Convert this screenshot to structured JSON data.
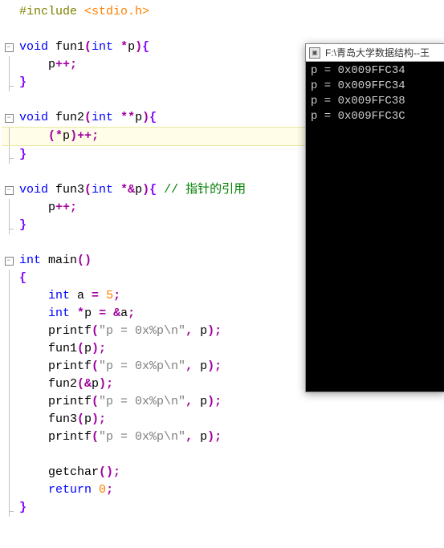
{
  "editor": {
    "lines": [
      {
        "fold": "none",
        "segments": [
          {
            "t": "#include ",
            "c": "inc"
          },
          {
            "t": "<stdio.h>",
            "c": "incfile"
          }
        ]
      },
      {
        "fold": "none",
        "segments": []
      },
      {
        "fold": "start",
        "segments": [
          {
            "t": "void",
            "c": "kw"
          },
          {
            "t": " fun1",
            "c": "ident"
          },
          {
            "t": "(",
            "c": "op"
          },
          {
            "t": "int",
            "c": "kw"
          },
          {
            "t": " ",
            "c": ""
          },
          {
            "t": "*",
            "c": "ptr"
          },
          {
            "t": "p",
            "c": "ident"
          },
          {
            "t": ")",
            "c": "op"
          },
          {
            "t": "{",
            "c": "brace"
          }
        ]
      },
      {
        "fold": "mid",
        "segments": [
          {
            "t": "    p",
            "c": "ident"
          },
          {
            "t": "++",
            "c": "op"
          },
          {
            "t": ";",
            "c": "op"
          }
        ]
      },
      {
        "fold": "end",
        "segments": [
          {
            "t": "}",
            "c": "brace"
          }
        ]
      },
      {
        "fold": "none",
        "segments": []
      },
      {
        "fold": "start",
        "segments": [
          {
            "t": "void",
            "c": "kw"
          },
          {
            "t": " fun2",
            "c": "ident"
          },
          {
            "t": "(",
            "c": "op"
          },
          {
            "t": "int",
            "c": "kw"
          },
          {
            "t": " ",
            "c": ""
          },
          {
            "t": "**",
            "c": "ptr"
          },
          {
            "t": "p",
            "c": "ident"
          },
          {
            "t": ")",
            "c": "op"
          },
          {
            "t": "{",
            "c": "brace"
          }
        ]
      },
      {
        "fold": "mid",
        "highlight": true,
        "segments": [
          {
            "t": "    ",
            "c": ""
          },
          {
            "t": "(",
            "c": "op"
          },
          {
            "t": "*",
            "c": "ptr"
          },
          {
            "t": "p",
            "c": "ident"
          },
          {
            "t": ")",
            "c": "op"
          },
          {
            "t": "++",
            "c": "op"
          },
          {
            "t": ";",
            "c": "op"
          }
        ]
      },
      {
        "fold": "end",
        "segments": [
          {
            "t": "}",
            "c": "brace"
          }
        ]
      },
      {
        "fold": "none",
        "segments": []
      },
      {
        "fold": "start",
        "segments": [
          {
            "t": "void",
            "c": "kw"
          },
          {
            "t": " fun3",
            "c": "ident"
          },
          {
            "t": "(",
            "c": "op"
          },
          {
            "t": "int",
            "c": "kw"
          },
          {
            "t": " ",
            "c": ""
          },
          {
            "t": "*&",
            "c": "ptr"
          },
          {
            "t": "p",
            "c": "ident"
          },
          {
            "t": ")",
            "c": "op"
          },
          {
            "t": "{",
            "c": "brace"
          },
          {
            "t": " ",
            "c": ""
          },
          {
            "t": "// 指针的引用",
            "c": "cmt"
          }
        ]
      },
      {
        "fold": "mid",
        "segments": [
          {
            "t": "    p",
            "c": "ident"
          },
          {
            "t": "++",
            "c": "op"
          },
          {
            "t": ";",
            "c": "op"
          }
        ]
      },
      {
        "fold": "end",
        "segments": [
          {
            "t": "}",
            "c": "brace"
          }
        ]
      },
      {
        "fold": "none",
        "segments": []
      },
      {
        "fold": "start",
        "segments": [
          {
            "t": "int",
            "c": "kw"
          },
          {
            "t": " main",
            "c": "ident"
          },
          {
            "t": "()",
            "c": "op"
          }
        ]
      },
      {
        "fold": "mid",
        "segments": [
          {
            "t": "{",
            "c": "brace"
          }
        ]
      },
      {
        "fold": "mid",
        "segments": [
          {
            "t": "    ",
            "c": ""
          },
          {
            "t": "int",
            "c": "kw"
          },
          {
            "t": " a ",
            "c": "ident"
          },
          {
            "t": "=",
            "c": "op"
          },
          {
            "t": " ",
            "c": ""
          },
          {
            "t": "5",
            "c": "num"
          },
          {
            "t": ";",
            "c": "op"
          }
        ]
      },
      {
        "fold": "mid",
        "segments": [
          {
            "t": "    ",
            "c": ""
          },
          {
            "t": "int",
            "c": "kw"
          },
          {
            "t": " ",
            "c": ""
          },
          {
            "t": "*",
            "c": "ptr"
          },
          {
            "t": "p ",
            "c": "ident"
          },
          {
            "t": "=",
            "c": "op"
          },
          {
            "t": " ",
            "c": ""
          },
          {
            "t": "&",
            "c": "ptr"
          },
          {
            "t": "a",
            "c": "ident"
          },
          {
            "t": ";",
            "c": "op"
          }
        ]
      },
      {
        "fold": "mid",
        "segments": [
          {
            "t": "    printf",
            "c": "ident"
          },
          {
            "t": "(",
            "c": "op"
          },
          {
            "t": "\"p = 0x%p\\n\"",
            "c": "str"
          },
          {
            "t": ",",
            "c": "op"
          },
          {
            "t": " p",
            "c": "ident"
          },
          {
            "t": ");",
            "c": "op"
          }
        ]
      },
      {
        "fold": "mid",
        "segments": [
          {
            "t": "    fun1",
            "c": "ident"
          },
          {
            "t": "(",
            "c": "op"
          },
          {
            "t": "p",
            "c": "ident"
          },
          {
            "t": ");",
            "c": "op"
          }
        ]
      },
      {
        "fold": "mid",
        "segments": [
          {
            "t": "    printf",
            "c": "ident"
          },
          {
            "t": "(",
            "c": "op"
          },
          {
            "t": "\"p = 0x%p\\n\"",
            "c": "str"
          },
          {
            "t": ",",
            "c": "op"
          },
          {
            "t": " p",
            "c": "ident"
          },
          {
            "t": ");",
            "c": "op"
          }
        ]
      },
      {
        "fold": "mid",
        "segments": [
          {
            "t": "    fun2",
            "c": "ident"
          },
          {
            "t": "(",
            "c": "op"
          },
          {
            "t": "&",
            "c": "ptr"
          },
          {
            "t": "p",
            "c": "ident"
          },
          {
            "t": ");",
            "c": "op"
          }
        ]
      },
      {
        "fold": "mid",
        "segments": [
          {
            "t": "    printf",
            "c": "ident"
          },
          {
            "t": "(",
            "c": "op"
          },
          {
            "t": "\"p = 0x%p\\n\"",
            "c": "str"
          },
          {
            "t": ",",
            "c": "op"
          },
          {
            "t": " p",
            "c": "ident"
          },
          {
            "t": ");",
            "c": "op"
          }
        ]
      },
      {
        "fold": "mid",
        "segments": [
          {
            "t": "    fun3",
            "c": "ident"
          },
          {
            "t": "(",
            "c": "op"
          },
          {
            "t": "p",
            "c": "ident"
          },
          {
            "t": ");",
            "c": "op"
          }
        ]
      },
      {
        "fold": "mid",
        "segments": [
          {
            "t": "    printf",
            "c": "ident"
          },
          {
            "t": "(",
            "c": "op"
          },
          {
            "t": "\"p = 0x%p\\n\"",
            "c": "str"
          },
          {
            "t": ",",
            "c": "op"
          },
          {
            "t": " p",
            "c": "ident"
          },
          {
            "t": ");",
            "c": "op"
          }
        ]
      },
      {
        "fold": "mid",
        "segments": []
      },
      {
        "fold": "mid",
        "segments": [
          {
            "t": "    getchar",
            "c": "ident"
          },
          {
            "t": "();",
            "c": "op"
          }
        ]
      },
      {
        "fold": "mid",
        "segments": [
          {
            "t": "    ",
            "c": ""
          },
          {
            "t": "return",
            "c": "kw"
          },
          {
            "t": " ",
            "c": ""
          },
          {
            "t": "0",
            "c": "num"
          },
          {
            "t": ";",
            "c": "op"
          }
        ]
      },
      {
        "fold": "end",
        "segments": [
          {
            "t": "}",
            "c": "brace"
          }
        ]
      }
    ]
  },
  "console": {
    "title": "F:\\青岛大学数据结构--王",
    "lines": [
      "p = 0x009FFC34",
      "p = 0x009FFC34",
      "p = 0x009FFC38",
      "p = 0x009FFC3C"
    ]
  }
}
